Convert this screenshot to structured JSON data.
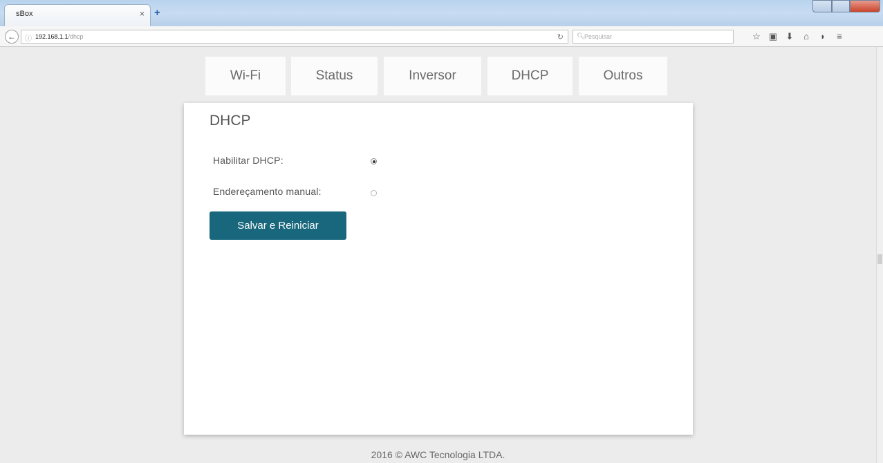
{
  "browser": {
    "tab_title": "sBox",
    "tab_close": "×",
    "new_tab": "+",
    "back": "←",
    "url_host": "192.168.1.1",
    "url_path": "/dhcp",
    "search_placeholder": "Pesquisar",
    "icons": [
      "star-icon",
      "clipboard-icon",
      "download-icon",
      "home-icon",
      "pocket-icon",
      "menu-icon"
    ]
  },
  "nav": {
    "tabs": [
      {
        "label": "Wi-Fi"
      },
      {
        "label": "Status"
      },
      {
        "label": "Inversor"
      },
      {
        "label": "DHCP"
      },
      {
        "label": "Outros"
      }
    ]
  },
  "panel": {
    "title": "DHCP",
    "options": [
      {
        "label": "Habilitar DHCP:",
        "checked": true
      },
      {
        "label": "Endereçamento manual:",
        "checked": false
      }
    ],
    "button_label": "Salvar e Reiniciar"
  },
  "footer": {
    "text": "2016 © AWC Tecnologia LTDA."
  },
  "colors": {
    "primary_button": "#19677c",
    "page_background": "#ececec",
    "card": "#ffffff"
  }
}
